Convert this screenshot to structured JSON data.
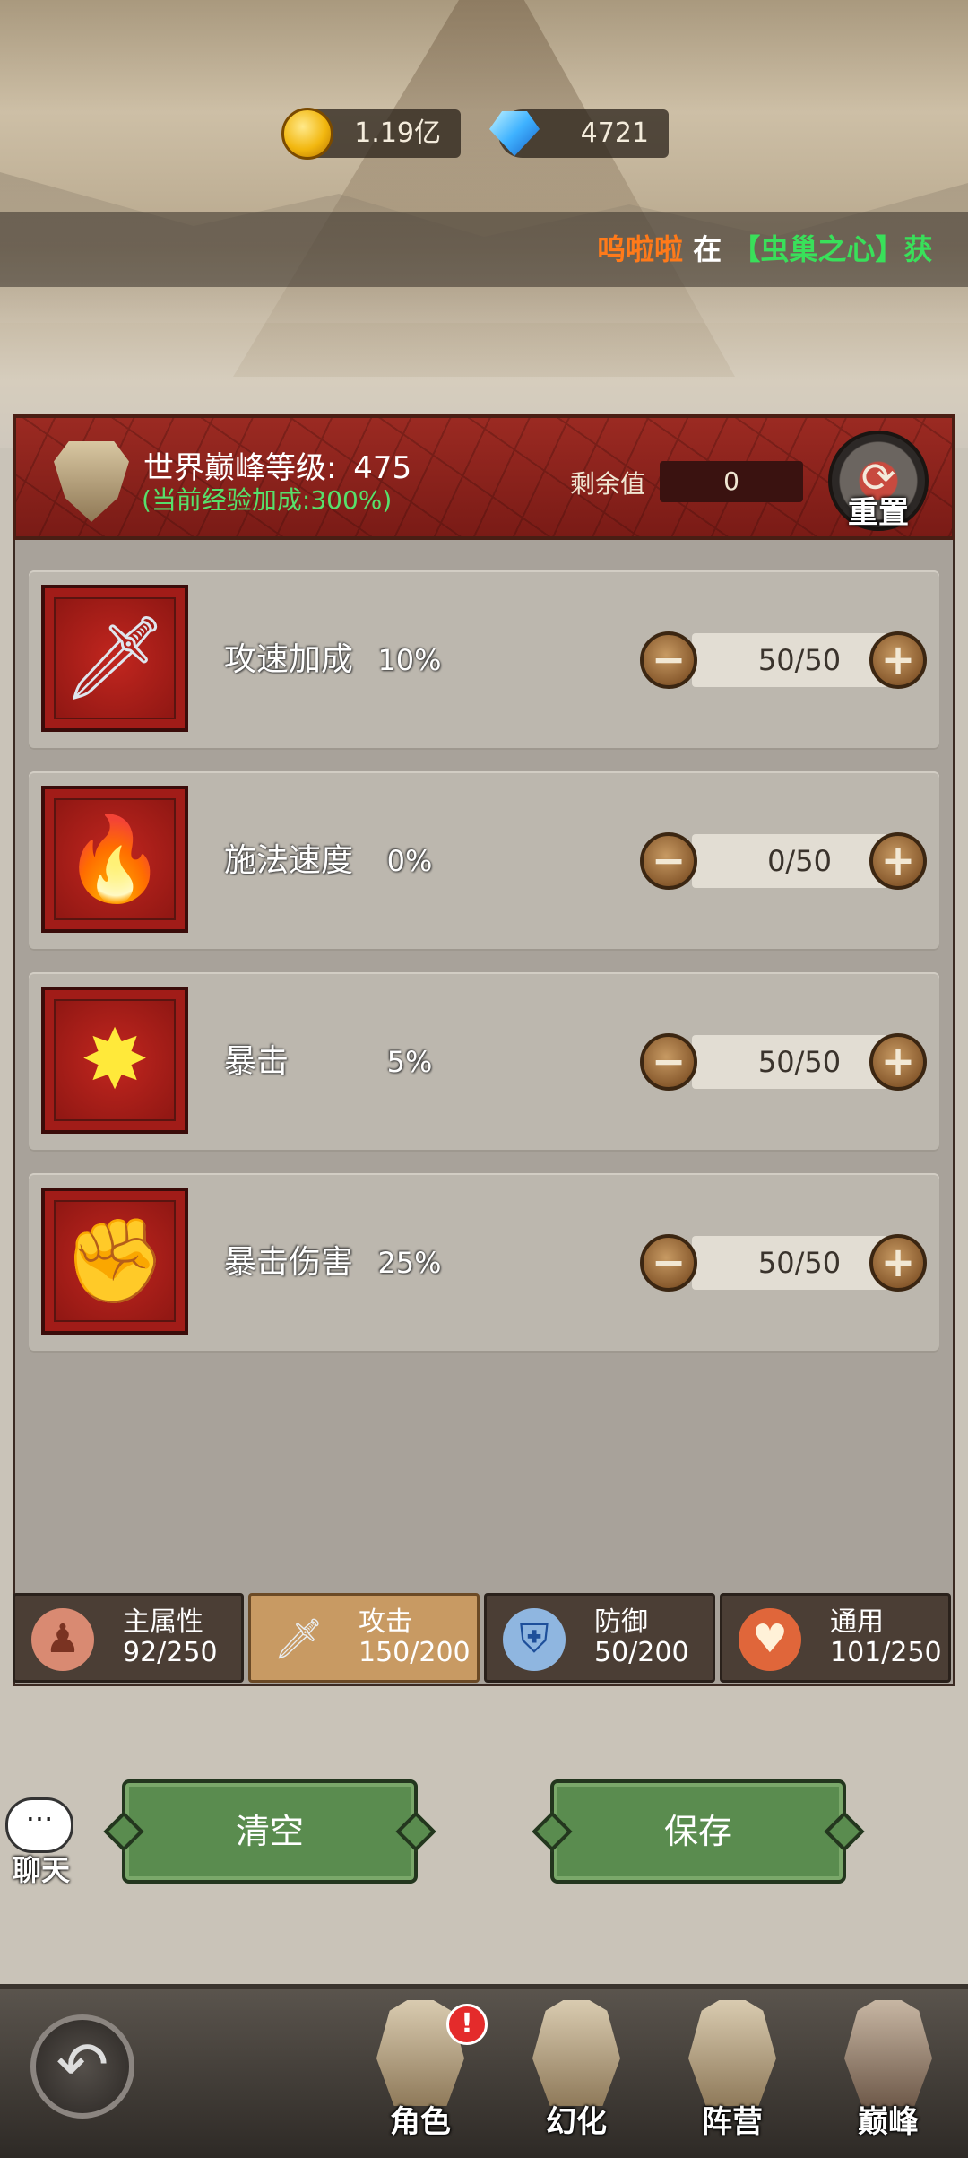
{
  "currency": {
    "gold": {
      "icon": "gold-coin-icon",
      "value": "1.19亿"
    },
    "gem": {
      "icon": "blue-gem-icon",
      "value": "4721"
    }
  },
  "ticker": {
    "user": "呜啦啦",
    "word": "在",
    "place": "【虫巢之心】",
    "tail": "获"
  },
  "header": {
    "title_label": "世界巅峰等级:",
    "level": "475",
    "exp_bonus": "(当前经验加成:300%)",
    "remain_label": "剩余值",
    "remain_value": "0",
    "reset_label": "重置"
  },
  "stats": [
    {
      "name": "攻速加成",
      "percent": "10%",
      "value": "50/50",
      "icon": "sword-lightning-icon"
    },
    {
      "name": "施法速度",
      "percent": "0%",
      "value": "0/50",
      "icon": "flame-lightning-icon"
    },
    {
      "name": "暴击",
      "percent": "5%",
      "value": "50/50",
      "icon": "burst-icon"
    },
    {
      "name": "暴击伤害",
      "percent": "25%",
      "value": "50/50",
      "icon": "fist-burst-icon"
    }
  ],
  "tabs": [
    {
      "name": "主属性",
      "progress": "92/250",
      "icon": "body-icon",
      "active": false
    },
    {
      "name": "攻击",
      "progress": "150/200",
      "icon": "sword-icon",
      "active": true
    },
    {
      "name": "防御",
      "progress": "50/200",
      "icon": "shield-icon",
      "active": false
    },
    {
      "name": "通用",
      "progress": "101/250",
      "icon": "heart-icon",
      "active": false
    }
  ],
  "buttons": {
    "clear": "清空",
    "save": "保存"
  },
  "chat": {
    "label": "聊天",
    "bubble": "···"
  },
  "nav": {
    "back_icon": "back-arrow-icon",
    "items": [
      {
        "label": "角色",
        "badge": "!"
      },
      {
        "label": "幻化"
      },
      {
        "label": "阵营"
      },
      {
        "label": "巅峰"
      }
    ]
  },
  "colors": {
    "header_red": "#7a1b16",
    "exp_green": "#57e06b",
    "button_green": "#5a8c4f",
    "ticker_orange": "#ff7a1a",
    "ticker_green": "#39e05a"
  }
}
